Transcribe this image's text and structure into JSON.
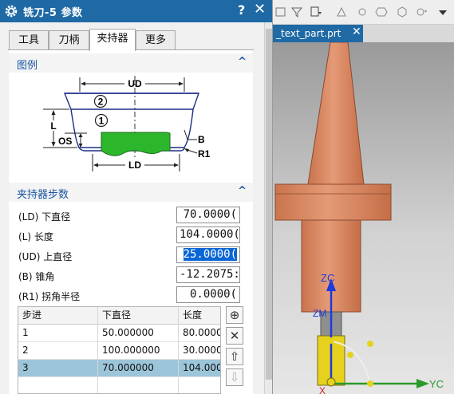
{
  "dialog": {
    "title": "铣刀-5 参数",
    "help": "?",
    "close": "✕",
    "tabs": [
      {
        "label": "工具"
      },
      {
        "label": "刀柄"
      },
      {
        "label": "夹持器"
      },
      {
        "label": "更多"
      }
    ],
    "legend_section": {
      "title": "图例",
      "caret": "^"
    },
    "diagram": {
      "ud": "UD",
      "ld": "LD",
      "l": "L",
      "os": "OS",
      "b": "B",
      "r1": "R1",
      "step1": "1",
      "step2": "2"
    },
    "params_section": {
      "title": "夹持器步数",
      "caret": "^"
    },
    "params": [
      {
        "label": "(LD) 下直径",
        "value": "70.0000("
      },
      {
        "label": "(L) 长度",
        "value": "104.0000("
      },
      {
        "label": "(UD) 上直径",
        "value": "25.0000("
      },
      {
        "label": "(B) 锥角",
        "value": "-12.2075:"
      },
      {
        "label": "(R1) 拐角半径",
        "value": "0.0000("
      }
    ],
    "table": {
      "headers": [
        "步进",
        "下直径",
        "长度"
      ],
      "rows": [
        {
          "step": "1",
          "lower_dia": "50.000000",
          "length": "80.0000("
        },
        {
          "step": "2",
          "lower_dia": "100.000000",
          "length": "30.0000("
        },
        {
          "step": "3",
          "lower_dia": "70.000000",
          "length": "104.000("
        }
      ],
      "selected_row": 2
    },
    "table_buttons": {
      "add": "⊕",
      "delete": "✕",
      "up": "⇧",
      "down": "⇩"
    }
  },
  "viewport": {
    "file_tab": "_text_part.prt",
    "file_tab_close": "✕",
    "axis_labels": {
      "zc": "ZC",
      "zm": "ZM",
      "yc": "YC",
      "xc": "X"
    },
    "colors": {
      "tool_body": "#d9825b",
      "tool_edge": "#8a4a2e",
      "arbor": "#8a8a8a",
      "gold": "#e6d21e",
      "axis_blue": "#1c39e0",
      "axis_green": "#2a9a2a",
      "axis_red": "#d62020"
    }
  }
}
